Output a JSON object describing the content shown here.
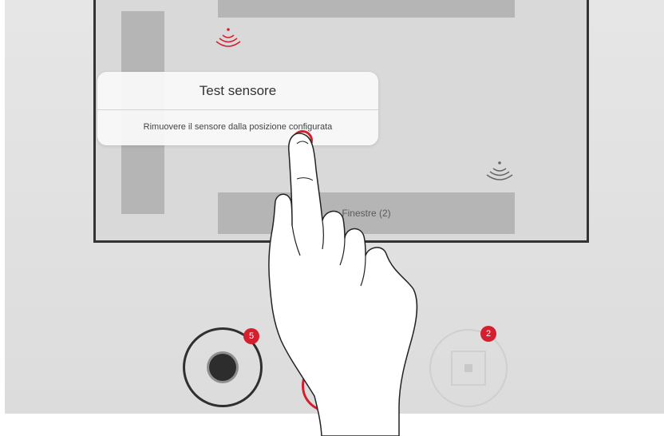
{
  "floorplan": {
    "block_bottom_label": "Finestre (2)"
  },
  "dialog": {
    "title": "Test sensore",
    "message": "Rimuovere il sensore dalla posizione configurata"
  },
  "controls": {
    "record_badge": "5",
    "stop_badge": "2"
  },
  "icons": {
    "sensor_active": "wireless-signal-icon",
    "sensor_idle": "wireless-signal-icon",
    "record": "record-icon",
    "stop": "stop-icon",
    "hand": "pointing-hand-icon"
  },
  "colors": {
    "accent_red": "#d4202e",
    "dark": "#2f2f2f",
    "panel_gray": "#b5b5b5",
    "background": "#dcdcdc"
  }
}
